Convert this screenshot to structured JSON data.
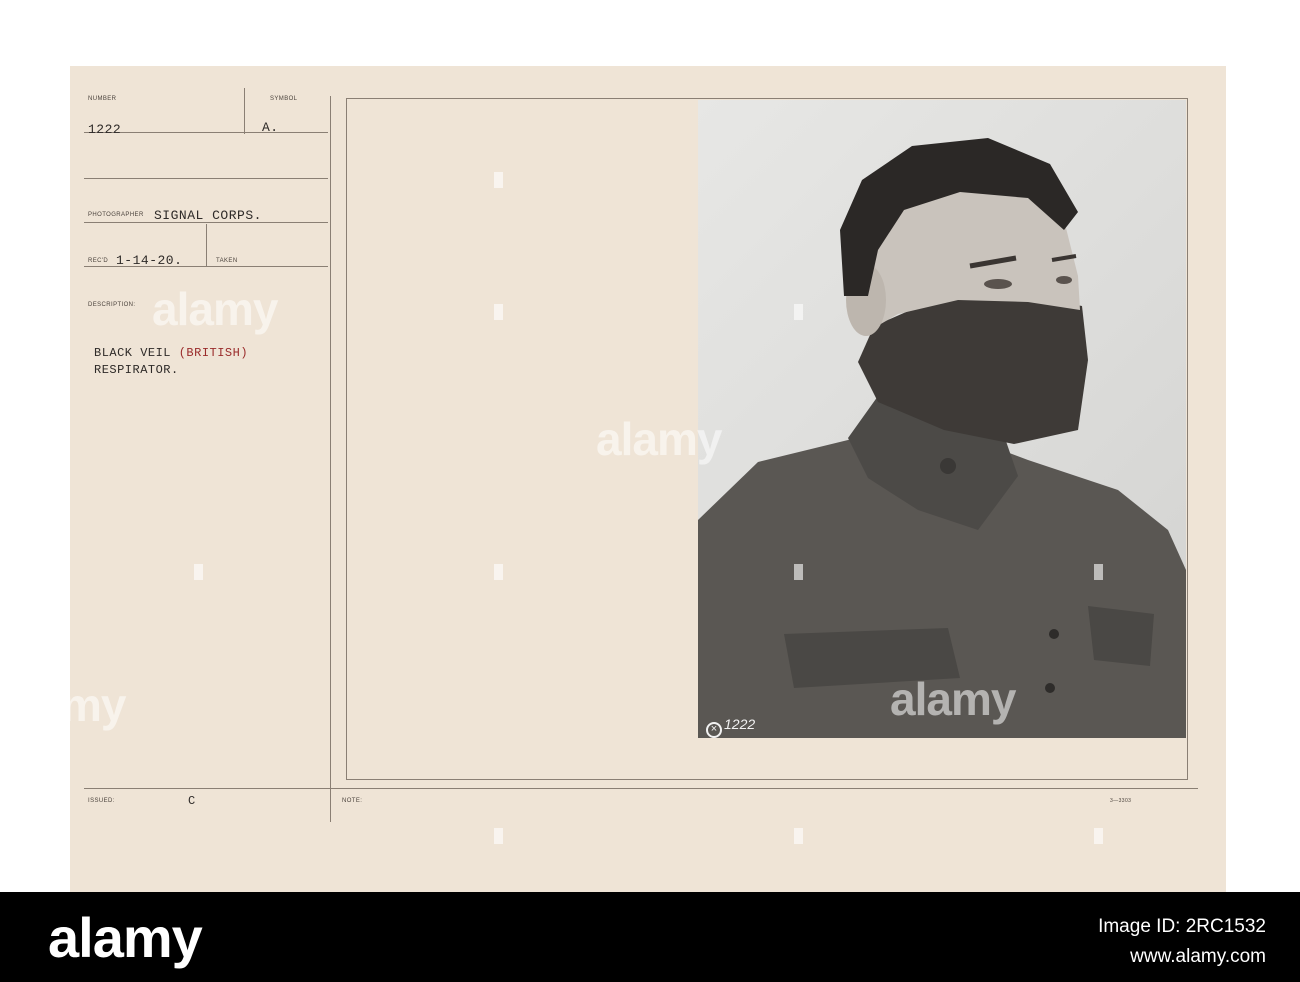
{
  "card": {
    "number_label": "NUMBER",
    "number_value": "1222",
    "symbol_label": "SYMBOL",
    "symbol_value": "A.",
    "photographer_label": "PHOTOGRAPHER",
    "photographer_value": "SIGNAL CORPS.",
    "recd_label": "REC'D",
    "recd_value": "1-14-20.",
    "taken_label": "TAKEN",
    "description_label": "DESCRIPTION:",
    "description_line1_a": "BLACK VEIL ",
    "description_line1_b": "(BRITISH)",
    "description_line2": "RESPIRATOR.",
    "issued_label": "ISSUED:",
    "issued_value": "C",
    "note_label": "NOTE:",
    "form_code": "3—3303"
  },
  "photo": {
    "print_number": "1222"
  },
  "watermark_text": "alamy",
  "footer": {
    "logo_text": "alamy",
    "image_id": "Image ID: 2RC1532",
    "site": "www.alamy.com"
  }
}
